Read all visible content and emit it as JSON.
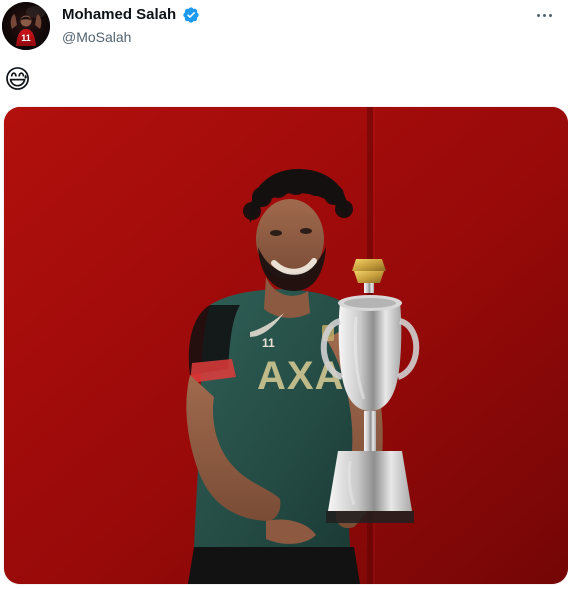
{
  "tweet": {
    "author": {
      "display_name": "Mohamed Salah",
      "handle": "@MoSalah"
    },
    "text": "😅",
    "media": {
      "type": "photo",
      "alt": "",
      "shirt_number": "11",
      "sponsor": "AXA"
    },
    "colors": {
      "verified": "#1d9bf0",
      "background_red": "#b30a08",
      "shirt_green": "#2f5f56"
    },
    "icons": {
      "verified": "verified-badge-icon",
      "more": "more-dots-icon"
    }
  }
}
